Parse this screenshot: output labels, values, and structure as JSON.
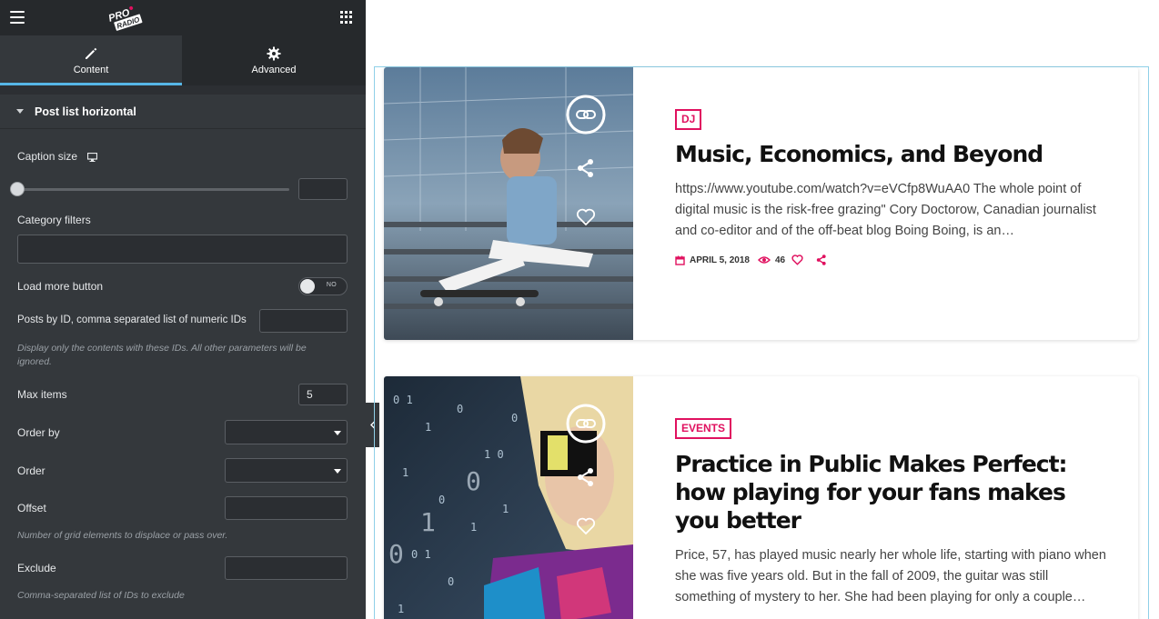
{
  "sidebar": {
    "logo_text": "PRO RADIO",
    "tabs": [
      {
        "label": "Content",
        "icon": "pencil-icon",
        "active": true
      },
      {
        "label": "Advanced",
        "icon": "gear-icon",
        "active": false
      }
    ],
    "section_title": "Post list horizontal",
    "controls": {
      "caption_size_label": "Caption size",
      "caption_size_value": "",
      "category_filters_label": "Category filters",
      "category_filters_value": "",
      "load_more_label": "Load more button",
      "load_more_switch": "NO",
      "posts_by_id_label": "Posts by ID, comma separated list of numeric IDs",
      "posts_by_id_value": "",
      "posts_by_id_hint": "Display only the contents with these IDs. All other parameters will be ignored.",
      "max_items_label": "Max items",
      "max_items_value": "5",
      "order_by_label": "Order by",
      "order_by_value": "",
      "order_label": "Order",
      "order_value": "",
      "offset_label": "Offset",
      "offset_value": "",
      "offset_hint": "Number of grid elements to displace or pass over.",
      "exclude_label": "Exclude",
      "exclude_value": "",
      "exclude_hint": "Comma-separated list of IDs to exclude"
    }
  },
  "posts": [
    {
      "category": "DJ",
      "title": "Music, Economics, and Beyond",
      "excerpt": "https://www.youtube.com/watch?v=eVCfp8WuAA0 The whole point of digital music is the risk-free grazing\" Cory Doctorow, Canadian journalist and co-editor and of the off-beat blog Boing Boing, is an…",
      "date": "APRIL 5, 2018",
      "views": "46"
    },
    {
      "category": "EVENTS",
      "title": "Practice in Public Makes Perfect: how playing for your fans makes you better",
      "excerpt": "Price, 57, has played music nearly her whole life, starting with piano when she was five years old. But in the fall of 2009, the guitar was still something of mystery to her. She had been playing for only a couple…"
    }
  ],
  "colors": {
    "accent": "#e0115f",
    "sidebar_bg": "#34383c",
    "tab_indicator": "#56b6e6"
  }
}
